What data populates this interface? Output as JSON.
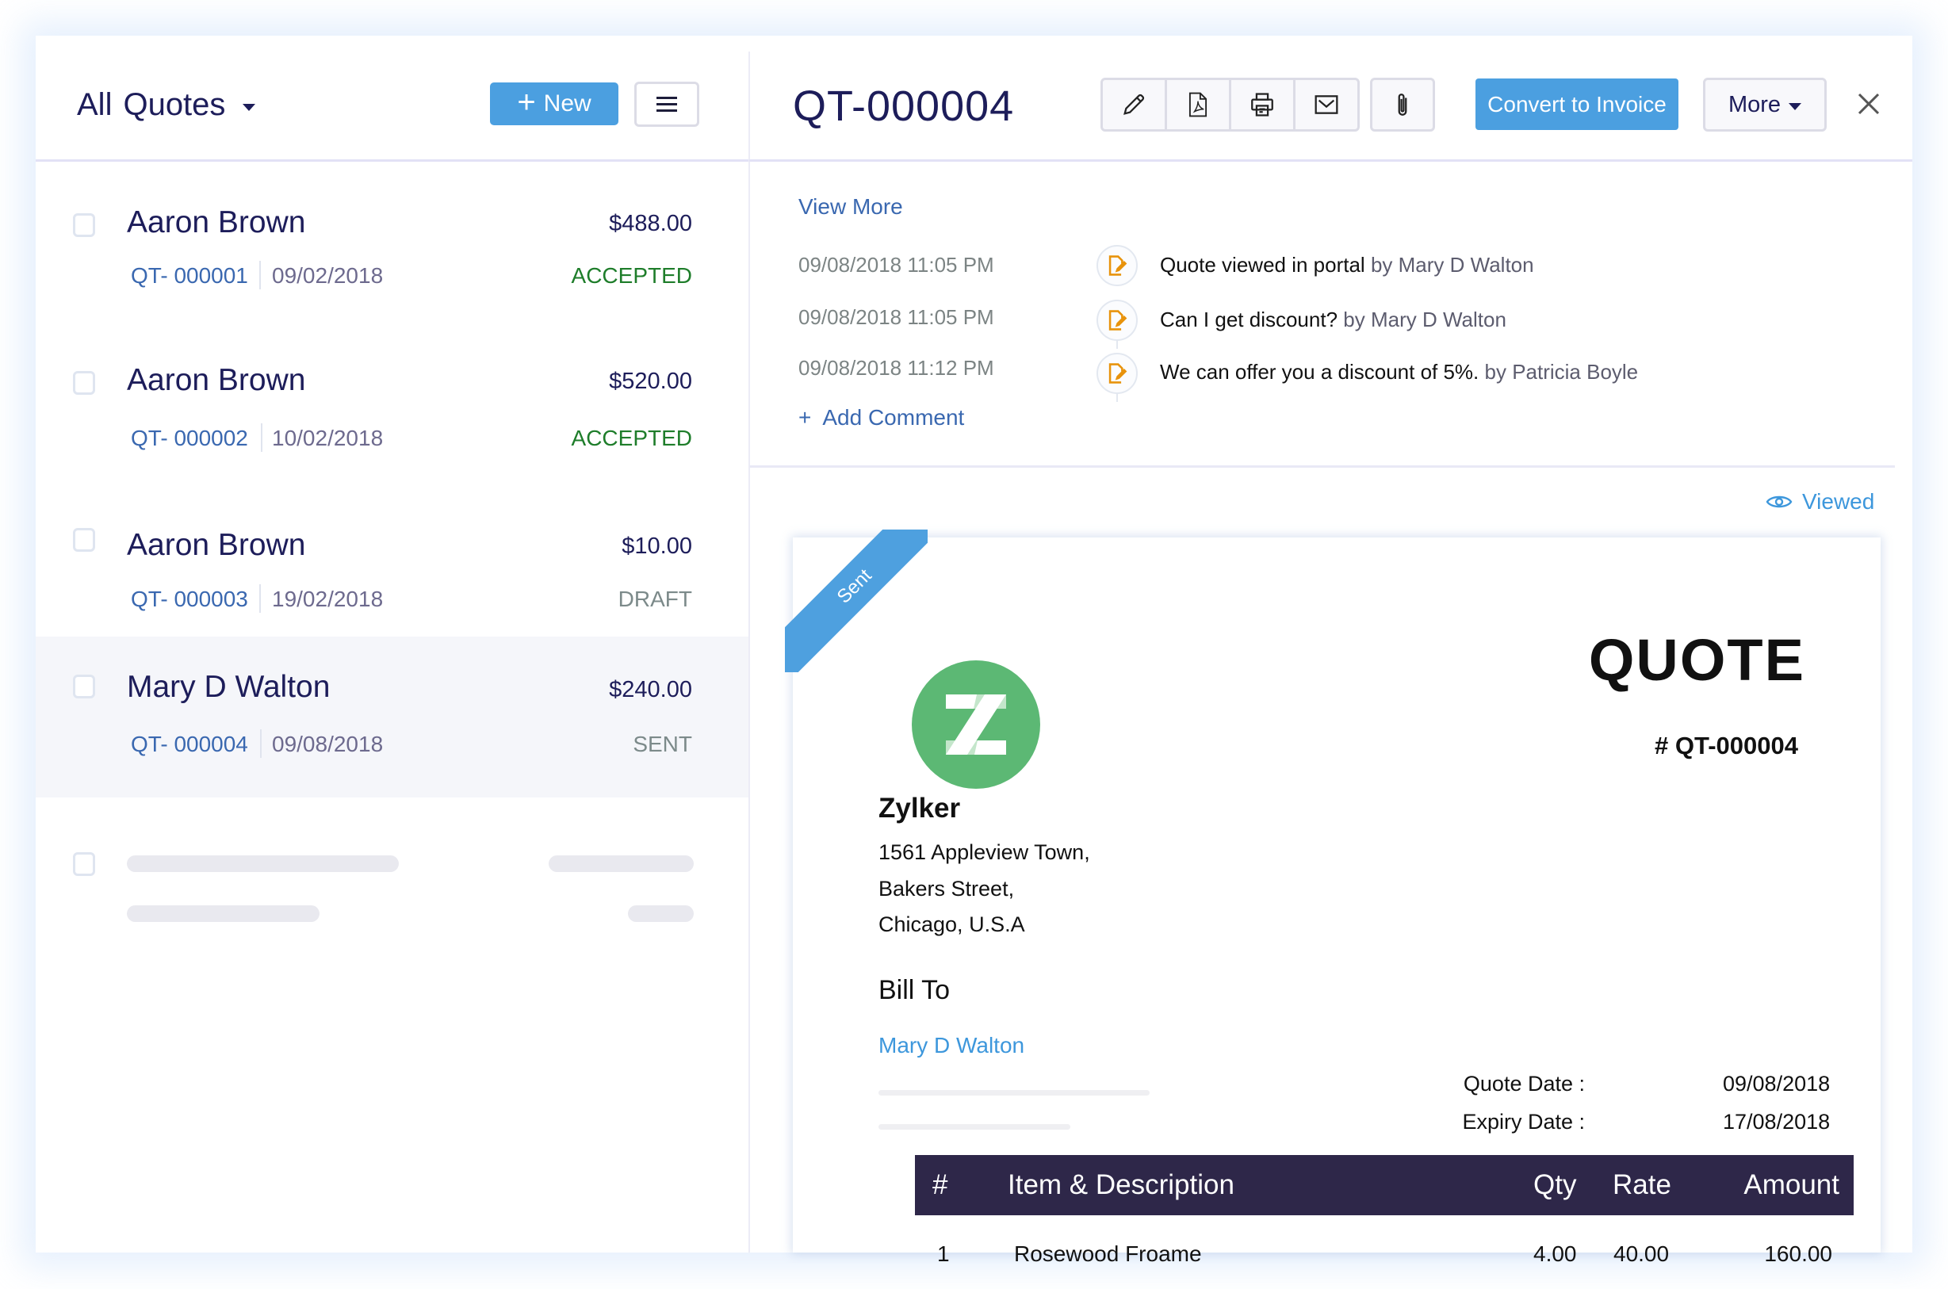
{
  "list": {
    "filter_prefix": "All",
    "filter_label": "Quotes",
    "new_button_label": "New",
    "menu_icon": "hamburger-menu-icon",
    "items": [
      {
        "name": "Aaron Brown",
        "amount": "$488.00",
        "number": "QT- 000001",
        "date": "09/02/2018",
        "status": "ACCEPTED"
      },
      {
        "name": "Aaron Brown",
        "amount": "$520.00",
        "number": "QT- 000002",
        "date": "10/02/2018",
        "status": "ACCEPTED"
      },
      {
        "name": "Aaron Brown",
        "amount": "$10.00",
        "number": "QT- 000003",
        "date": "19/02/2018",
        "status": "DRAFT"
      },
      {
        "name": "Mary D Walton",
        "amount": "$240.00",
        "number": "QT- 000004",
        "date": "09/08/2018",
        "status": "SENT",
        "selected": true
      }
    ]
  },
  "detail": {
    "title": "QT-000004",
    "toolbar": {
      "icons": [
        "edit-pencil-icon",
        "pdf-icon",
        "print-icon",
        "email-icon",
        "attachment-icon"
      ],
      "convert_label": "Convert to Invoice",
      "more_label": "More",
      "close_icon": "close-icon"
    },
    "comments": {
      "view_more_label": "View More",
      "entries": [
        {
          "time": "09/08/2018  11:05 PM",
          "text": "Quote viewed in portal",
          "by": " by Mary D Walton"
        },
        {
          "time": "09/08/2018  11:05 PM",
          "text": "Can I get discount?",
          "by": " by Mary D Walton"
        },
        {
          "time": "09/08/2018  11:12 PM",
          "text": "We can offer you a discount of 5%.",
          "by": " by Patricia Boyle"
        }
      ],
      "add_comment_label": "Add Comment"
    },
    "viewed_label": "Viewed",
    "document": {
      "ribbon_label": "Sent",
      "logo_letter": "Z",
      "doc_title": "QUOTE",
      "doc_number": "# QT-000004",
      "company_name": "Zylker",
      "address_lines": [
        "1561 Appleview Town,",
        "Bakers Street,",
        "Chicago, U.S.A"
      ],
      "bill_to_label": "Bill To",
      "bill_to_name": "Mary D Walton",
      "quote_date_label": "Quote Date :",
      "quote_date": "09/08/2018",
      "expiry_date_label": "Expiry Date :",
      "expiry_date": "17/08/2018",
      "table": {
        "headers": {
          "num": "#",
          "item": "Item & Description",
          "qty": "Qty",
          "rate": "Rate",
          "amount": "Amount"
        },
        "rows": [
          {
            "num": "1",
            "item": "Rosewood Froame",
            "qty": "4.00",
            "rate": "40.00",
            "amount": "160.00"
          }
        ]
      }
    }
  },
  "colors": {
    "accent_blue": "#4b9fe0",
    "text_navy": "#1d1d5a",
    "link_blue": "#3a68b0",
    "accepted_green": "#1e7d2a",
    "table_header": "#2e2749",
    "logo_green": "#5cb874",
    "comment_icon_orange": "#e8930c"
  }
}
